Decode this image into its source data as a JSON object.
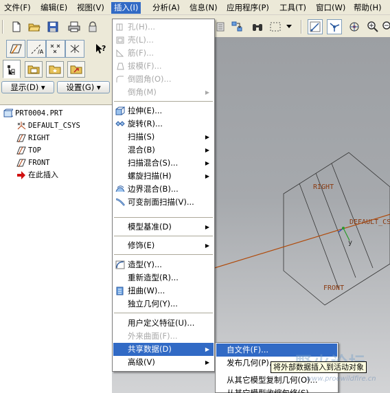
{
  "menubar": {
    "items": [
      {
        "label": "文件(F)"
      },
      {
        "label": "编辑(E)"
      },
      {
        "label": "视图(V)"
      },
      {
        "label": "插入(I)"
      },
      {
        "label": "分析(A)"
      },
      {
        "label": "信息(N)"
      },
      {
        "label": "应用程序(P)"
      },
      {
        "label": "工具(T)"
      },
      {
        "label": "窗口(W)"
      },
      {
        "label": "帮助(H)"
      }
    ]
  },
  "toolbar": {
    "icons": [
      "new-file-icon",
      "open-folder-icon",
      "save-icon",
      "print-icon",
      "lock-icon",
      "datum-axis-icon",
      "regenerate-icon",
      "binoculars-icon",
      "select-box-icon",
      "dropdown-icon",
      "model-tree-icon",
      "datum-csys-icon",
      "spin-icon",
      "zoom-in-icon",
      "zoom-out-icon"
    ]
  },
  "left_panel": {
    "display_button": "显示(D) ▾",
    "settings_button": "设置(G) ▾",
    "tree": [
      {
        "label": "PRT0004.PRT",
        "icon": "part-icon"
      },
      {
        "label": "DEFAULT_CSYS",
        "icon": "csys-icon"
      },
      {
        "label": "RIGHT",
        "icon": "datum-plane-icon"
      },
      {
        "label": "TOP",
        "icon": "datum-plane-icon"
      },
      {
        "label": "FRONT",
        "icon": "datum-plane-icon"
      },
      {
        "label": "在此插入",
        "icon": "insert-here-arrow-icon"
      }
    ]
  },
  "insert_menu": {
    "items": [
      {
        "label": "孔(H)...",
        "disabled": true
      },
      {
        "label": "壳(L)...",
        "disabled": true
      },
      {
        "label": "筋(F)...",
        "disabled": true
      },
      {
        "label": "拔模(F)...",
        "disabled": true
      },
      {
        "label": "倒圆角(O)...",
        "disabled": true
      },
      {
        "label": "倒角(M)",
        "disabled": true
      },
      {
        "label": "拉伸(E)..."
      },
      {
        "label": "旋转(R)..."
      },
      {
        "label": "扫描(S)"
      },
      {
        "label": "混合(B)"
      },
      {
        "label": "扫描混合(S)..."
      },
      {
        "label": "螺旋扫描(H)"
      },
      {
        "label": "边界混合(B)..."
      },
      {
        "label": "可变剖面扫描(V)..."
      },
      {
        "label": "模型基准(D)"
      },
      {
        "label": "修饰(E)"
      },
      {
        "label": "造型(Y)..."
      },
      {
        "label": "重新造型(R)..."
      },
      {
        "label": "扭曲(W)..."
      },
      {
        "label": "独立几何(Y)..."
      },
      {
        "label": "用户定义特征(U)..."
      },
      {
        "label": "外来曲面(F)...",
        "disabled": true
      },
      {
        "label": "共享数据(D)",
        "highlighted": true
      },
      {
        "label": "高级(V)"
      }
    ]
  },
  "shared_data_submenu": {
    "items": [
      {
        "label": "自文件(F)...",
        "highlighted": true
      },
      {
        "label": "发布几何(P)..."
      },
      {
        "label": "从其它模型复制几何(O)..."
      },
      {
        "label": "从其它模型收缩包络(S)..."
      }
    ]
  },
  "tooltip": {
    "text": "将外部数据插入到活动对象"
  },
  "viewport": {
    "labels": {
      "right": "RIGHT",
      "csys": "DEFAULT_CS",
      "front": "FRONT",
      "y_axis": "y"
    }
  },
  "watermark": {
    "title": "野火论坛",
    "url": "www.proewildfire.cn"
  },
  "colors": {
    "highlight": "#316ac5",
    "menubar_bg": "#ece9d8",
    "datum_label": "#8a3a10"
  }
}
